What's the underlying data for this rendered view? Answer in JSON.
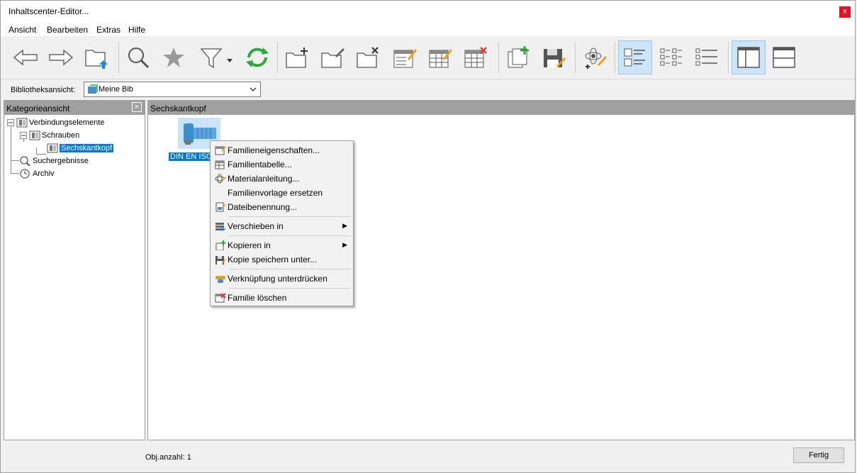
{
  "window": {
    "title": "Inhaltscenter-Editor...",
    "close_glyph": "x"
  },
  "menubar": [
    "Ansicht",
    "Bearbeiten",
    "Extras",
    "Hilfe"
  ],
  "toolbar": {
    "buttons": [
      {
        "icon": "back-arrow-icon"
      },
      {
        "icon": "forward-arrow-icon"
      },
      {
        "icon": "folder-up-icon"
      },
      {
        "icon": "search-icon"
      },
      {
        "icon": "favorites-star-icon"
      },
      {
        "icon": "filter-icon"
      },
      {
        "icon": "refresh-icon"
      },
      {
        "icon": "new-category-icon"
      },
      {
        "icon": "edit-category-icon"
      },
      {
        "icon": "delete-category-icon"
      },
      {
        "icon": "family-properties-icon"
      },
      {
        "icon": "family-table-icon"
      },
      {
        "icon": "delete-family-icon"
      },
      {
        "icon": "copy-to-icon"
      },
      {
        "icon": "save-copy-icon"
      },
      {
        "icon": "material-guide-icon"
      },
      {
        "icon": "view-large-icons-icon",
        "active": true
      },
      {
        "icon": "view-small-icons-icon"
      },
      {
        "icon": "view-list-icon"
      },
      {
        "icon": "layout-vertical-icon",
        "active": true
      },
      {
        "icon": "layout-horizontal-icon"
      }
    ]
  },
  "library": {
    "label": "Bibliotheksansicht:",
    "selected": "Meine Bib"
  },
  "category_pane": {
    "title": "Kategorieansicht",
    "tree": [
      {
        "label": "Verbindungselemente",
        "level": 0,
        "icon": "category-icon"
      },
      {
        "label": "Schrauben",
        "level": 1,
        "icon": "category-icon"
      },
      {
        "label": "Sechskantkopf",
        "level": 2,
        "icon": "category-icon",
        "selected": true
      },
      {
        "label": "Suchergebnisse",
        "level": 0,
        "icon": "search-icon"
      },
      {
        "label": "Archiv",
        "level": 0,
        "icon": "clock-icon"
      }
    ]
  },
  "content_pane": {
    "title": "Sechskantkopf",
    "item": {
      "label": "DIN EN ISO"
    }
  },
  "context_menu": {
    "items": [
      {
        "label": "Familieneigenschaften...",
        "icon": "family-properties-icon"
      },
      {
        "label": "Familientabelle...",
        "icon": "family-table-icon"
      },
      {
        "label": "Materialanleitung...",
        "icon": "material-guide-icon"
      },
      {
        "label": "Familienvorlage ersetzen",
        "icon": ""
      },
      {
        "label": "Dateibenennung...",
        "icon": "file-naming-icon"
      },
      {
        "label": "Verschieben in",
        "icon": "move-to-icon",
        "submenu": true
      },
      {
        "label": "Kopieren in",
        "icon": "copy-to-icon",
        "submenu": true
      },
      {
        "label": "Kopie speichern unter...",
        "icon": "save-copy-icon"
      },
      {
        "label": "Verknüpfung unterdrücken",
        "icon": "suppress-link-icon"
      },
      {
        "label": "Familie löschen",
        "icon": "delete-family-icon"
      }
    ]
  },
  "status": {
    "object_count": "Obj.anzahl: 1",
    "done_button": "Fertig"
  },
  "colors": {
    "accent": "#0078d7",
    "header_gray": "#a0a0a0",
    "active_tool": "#cce4f7"
  }
}
